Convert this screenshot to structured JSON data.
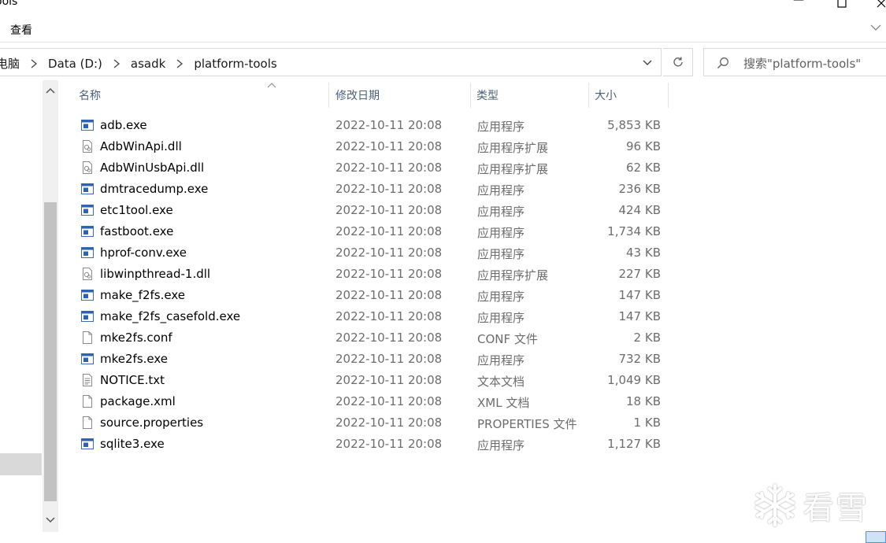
{
  "window": {
    "title": "ools",
    "minimize_glyph": "—",
    "maximize_glyph": "☐",
    "close_glyph": "✕"
  },
  "ribbon": {
    "tab_view": "查看",
    "expand_icon": "chevron-down-icon"
  },
  "address": {
    "crumbs": [
      "电脑",
      "Data (D:)",
      "asadk",
      "platform-tools"
    ],
    "separator_icon": "chevron-right-icon",
    "dropdown_icon": "chevron-down-icon",
    "refresh_icon": "refresh-icon"
  },
  "search": {
    "placeholder": "搜索\"platform-tools\"",
    "icon": "search-icon"
  },
  "columns": {
    "name": "名称",
    "modified": "修改日期",
    "type": "类型",
    "size": "大小"
  },
  "files": [
    {
      "name": "adb.exe",
      "modified": "2022-10-11 20:08",
      "type": "应用程序",
      "size": "5,853 KB",
      "icon": "exe"
    },
    {
      "name": "AdbWinApi.dll",
      "modified": "2022-10-11 20:08",
      "type": "应用程序扩展",
      "size": "96 KB",
      "icon": "dll"
    },
    {
      "name": "AdbWinUsbApi.dll",
      "modified": "2022-10-11 20:08",
      "type": "应用程序扩展",
      "size": "62 KB",
      "icon": "dll"
    },
    {
      "name": "dmtracedump.exe",
      "modified": "2022-10-11 20:08",
      "type": "应用程序",
      "size": "236 KB",
      "icon": "exe"
    },
    {
      "name": "etc1tool.exe",
      "modified": "2022-10-11 20:08",
      "type": "应用程序",
      "size": "424 KB",
      "icon": "exe"
    },
    {
      "name": "fastboot.exe",
      "modified": "2022-10-11 20:08",
      "type": "应用程序",
      "size": "1,734 KB",
      "icon": "exe"
    },
    {
      "name": "hprof-conv.exe",
      "modified": "2022-10-11 20:08",
      "type": "应用程序",
      "size": "43 KB",
      "icon": "exe"
    },
    {
      "name": "libwinpthread-1.dll",
      "modified": "2022-10-11 20:08",
      "type": "应用程序扩展",
      "size": "227 KB",
      "icon": "dll"
    },
    {
      "name": "make_f2fs.exe",
      "modified": "2022-10-11 20:08",
      "type": "应用程序",
      "size": "147 KB",
      "icon": "exe"
    },
    {
      "name": "make_f2fs_casefold.exe",
      "modified": "2022-10-11 20:08",
      "type": "应用程序",
      "size": "147 KB",
      "icon": "exe"
    },
    {
      "name": "mke2fs.conf",
      "modified": "2022-10-11 20:08",
      "type": "CONF 文件",
      "size": "2 KB",
      "icon": "file"
    },
    {
      "name": "mke2fs.exe",
      "modified": "2022-10-11 20:08",
      "type": "应用程序",
      "size": "732 KB",
      "icon": "exe"
    },
    {
      "name": "NOTICE.txt",
      "modified": "2022-10-11 20:08",
      "type": "文本文档",
      "size": "1,049 KB",
      "icon": "txt"
    },
    {
      "name": "package.xml",
      "modified": "2022-10-11 20:08",
      "type": "XML 文档",
      "size": "18 KB",
      "icon": "file"
    },
    {
      "name": "source.properties",
      "modified": "2022-10-11 20:08",
      "type": "PROPERTIES 文件",
      "size": "1 KB",
      "icon": "file"
    },
    {
      "name": "sqlite3.exe",
      "modified": "2022-10-11 20:08",
      "type": "应用程序",
      "size": "1,127 KB",
      "icon": "exe"
    }
  ],
  "watermark": {
    "text": "看雪",
    "icon": "snowflake-icon"
  },
  "colors": {
    "exe_icon_blue": "#1e5fb4",
    "header_text": "#4c607a",
    "meta_text": "#6d6d6d"
  }
}
